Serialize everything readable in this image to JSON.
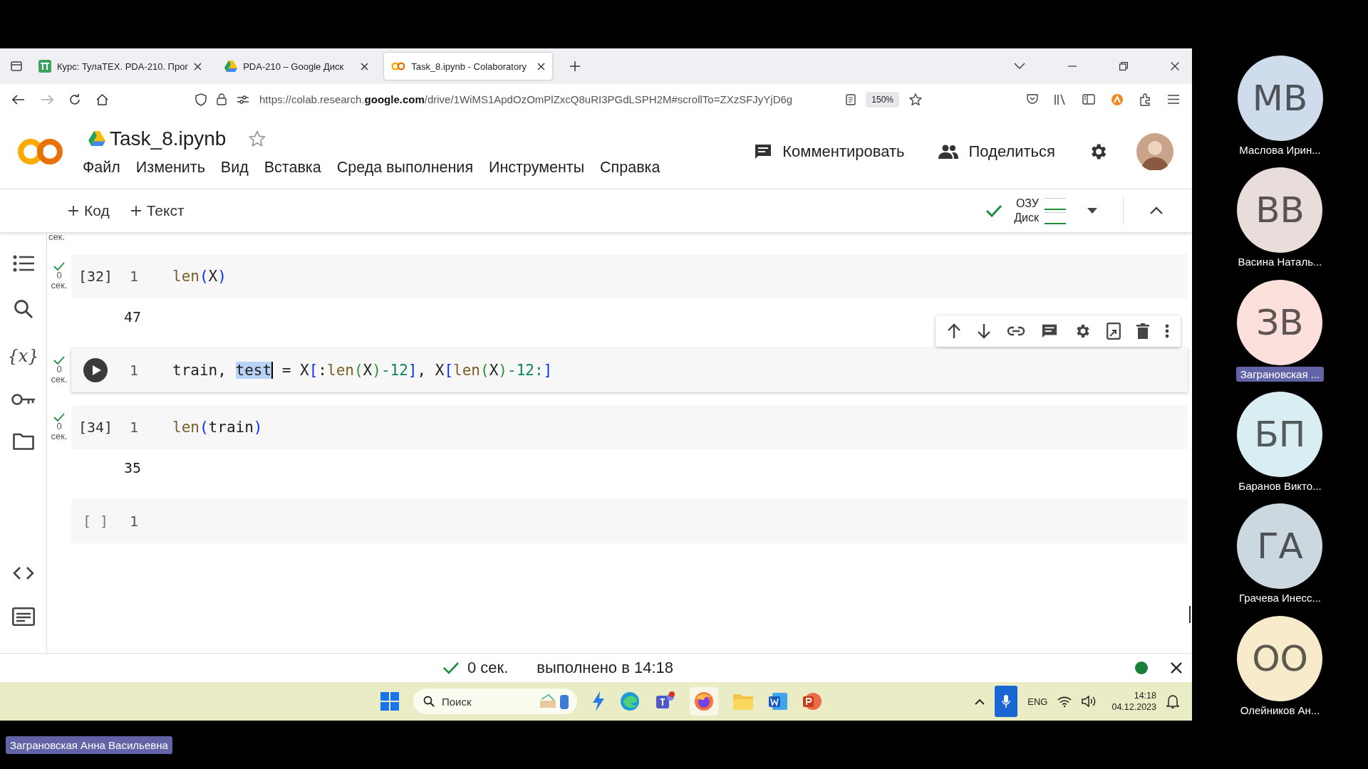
{
  "tabs": [
    {
      "title": "Курс: ТулаТЕХ. PDA-210. Прог",
      "selected": false
    },
    {
      "title": "PDA-210 – Google Диск",
      "selected": false
    },
    {
      "title": "Task_8.ipynb - Colaboratory",
      "selected": true
    }
  ],
  "address": {
    "url": "https://colab.research.**google.com**/drive/1WiMS1ApdOzOmPlZxcQ8uRI3PGdLSPH2M#scrollTo=ZXzSFJyYjD6g",
    "zoom": "150%"
  },
  "notebook": {
    "title": "Task_8.ipynb",
    "starred": false,
    "menu": [
      "Файл",
      "Изменить",
      "Вид",
      "Вставка",
      "Среда выполнения",
      "Инструменты",
      "Справка"
    ],
    "comment": "Комментировать",
    "share": "Поделиться"
  },
  "toolbar": {
    "add": [
      "Код",
      "Текст"
    ],
    "resources": [
      "ОЗУ",
      "Диск"
    ],
    "connected": true
  },
  "sidebar": [
    {
      "kind": "toc"
    },
    {
      "kind": "search"
    },
    {
      "kind": "glyph",
      "glyph": "{x}"
    },
    {
      "kind": "key"
    },
    {
      "kind": "folder"
    },
    {
      "kind": "gap"
    },
    {
      "kind": "code"
    },
    {
      "kind": "terminal"
    }
  ],
  "top_fragment": "сек.",
  "cells": [
    {
      "kind": "ran",
      "count": "[32]",
      "done": true,
      "time": "0",
      "unit": "сек.",
      "line": "1",
      "tokens": [
        {
          "text": "len",
          "kind": "function"
        },
        {
          "text": "(",
          "kind": "bracket"
        },
        {
          "text": "X",
          "kind": "name"
        },
        {
          "text": ")",
          "kind": "bracket"
        }
      ],
      "output": "47"
    },
    {
      "kind": "focused",
      "done": true,
      "time": "0",
      "unit": "сек.",
      "line": "1",
      "tokens": [
        {
          "text": "train, ",
          "kind": "name"
        },
        {
          "text": "test",
          "kind": "name",
          "selected": true
        },
        {
          "text": " = X",
          "kind": "name"
        },
        {
          "text": "[",
          "kind": "bracket"
        },
        {
          "text": ":",
          "kind": "name"
        },
        {
          "text": "len",
          "kind": "function"
        },
        {
          "text": "(",
          "kind": "paren"
        },
        {
          "text": "X",
          "kind": "name"
        },
        {
          "text": ")",
          "kind": "paren"
        },
        {
          "text": "-12",
          "kind": "number"
        },
        {
          "text": "]",
          "kind": "bracket"
        },
        {
          "text": ", X",
          "kind": "name"
        },
        {
          "text": "[",
          "kind": "bracket"
        },
        {
          "text": "len",
          "kind": "function"
        },
        {
          "text": "(",
          "kind": "paren"
        },
        {
          "text": "X",
          "kind": "name"
        },
        {
          "text": ")",
          "kind": "paren"
        },
        {
          "text": "-12:",
          "kind": "number"
        },
        {
          "text": "]",
          "kind": "bracket"
        }
      ]
    },
    {
      "kind": "ran",
      "count": "[34]",
      "done": true,
      "time": "0",
      "unit": "сек.",
      "line": "1",
      "tokens": [
        {
          "text": "len",
          "kind": "function"
        },
        {
          "text": "(",
          "kind": "bracket"
        },
        {
          "text": "train",
          "kind": "name"
        },
        {
          "text": ")",
          "kind": "bracket"
        }
      ],
      "output": "35"
    },
    {
      "kind": "ran",
      "count": "[ ]",
      "done": false,
      "line": "1"
    }
  ],
  "status": {
    "time": "0 сек.",
    "message": "выполнено в 14:18",
    "connected": true
  },
  "taskbar": {
    "search": "Поиск",
    "lang": "ENG",
    "time": "14:18",
    "date": "04.12.2023"
  },
  "participants": [
    {
      "initials": "МВ",
      "name": "Маслова Ирин...",
      "color": "#cfdcec",
      "highlighted": false
    },
    {
      "initials": "ВВ",
      "name": "Васина Наталь...",
      "color": "#e8ddda",
      "highlighted": false
    },
    {
      "initials": "ЗВ",
      "name": "Заграновская ...",
      "color": "#fbe0dc",
      "highlighted": true
    },
    {
      "initials": "БП",
      "name": "Баранов Викто...",
      "color": "#d9eef2",
      "highlighted": false
    },
    {
      "initials": "ГА",
      "name": "Грачева Инесс...",
      "color": "#ccd8e0",
      "highlighted": false
    },
    {
      "initials": "ОО",
      "name": "Олейников Ан...",
      "color": "#f7ebcc",
      "highlighted": false
    }
  ],
  "presenter": "Заграновская Анна Васильевна"
}
